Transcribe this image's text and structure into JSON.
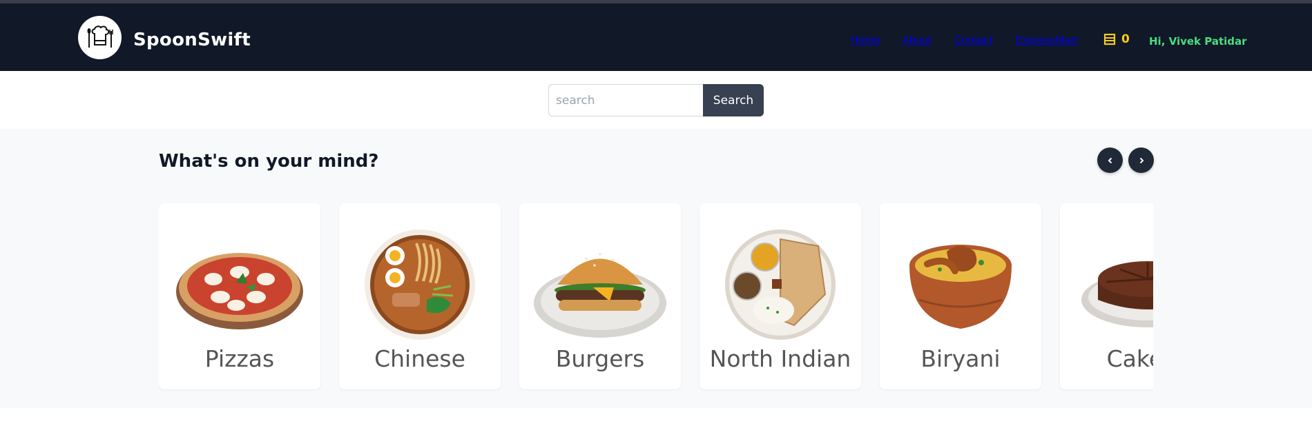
{
  "header": {
    "brand": "SpoonSwift",
    "logo_icon": "chef-hat-icon",
    "nav": [
      "Home",
      "About",
      "Contact",
      "ExpressMart"
    ],
    "cart_count": "0",
    "cart_icon": "cart-icon",
    "greeting": "Hi, Vivek Patidar"
  },
  "search": {
    "placeholder": "search",
    "value": "",
    "button_label": "Search"
  },
  "mind": {
    "title": "What's on your mind?",
    "prev_icon": "chevron-left-icon",
    "next_icon": "chevron-right-icon",
    "categories": [
      {
        "label": "Pizzas",
        "icon": "pizza-image"
      },
      {
        "label": "Chinese",
        "icon": "noodle-bowl-image"
      },
      {
        "label": "Burgers",
        "icon": "burger-image"
      },
      {
        "label": "North Indian",
        "icon": "thali-image"
      },
      {
        "label": "Biryani",
        "icon": "biryani-image"
      },
      {
        "label": "Cakes",
        "icon": "cake-image"
      }
    ]
  },
  "colors": {
    "navbar": "#111827",
    "cart": "#facc15",
    "greeting": "#4ade80",
    "section_bg": "#f8f9fa"
  }
}
